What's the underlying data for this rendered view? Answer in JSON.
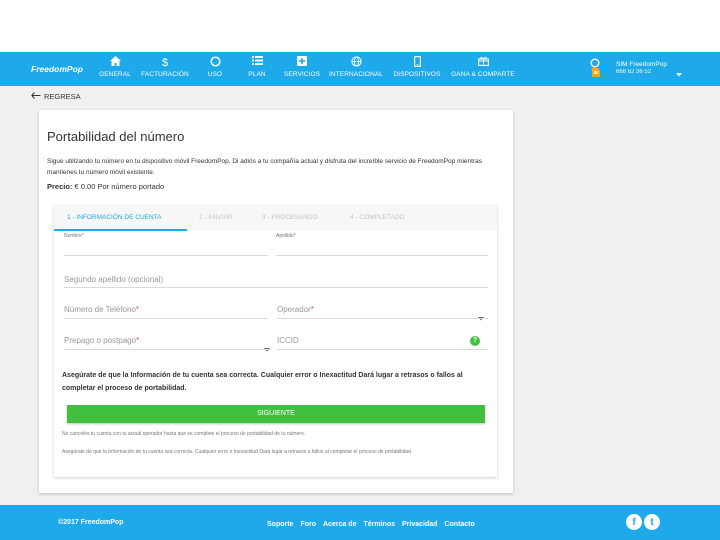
{
  "nav": {
    "logo": "FreedomPop",
    "items": [
      {
        "label": "GENERAL",
        "icon": "home-icon"
      },
      {
        "label": "FACTURACIÓN",
        "icon": "dollar-icon"
      },
      {
        "label": "USO",
        "icon": "circle-icon"
      },
      {
        "label": "PLAN",
        "icon": "list-icon"
      },
      {
        "label": "SERVICIOS",
        "icon": "plus-box-icon"
      },
      {
        "label": "INTERNACIONAL",
        "icon": "globe-icon"
      },
      {
        "label": "DISPOSITIVOS",
        "icon": "phone-icon"
      },
      {
        "label": "GANA & COMPARTE",
        "icon": "gift-icon"
      }
    ],
    "user": {
      "name": "SIM FreedomPop",
      "phone": "668 62 36 52"
    }
  },
  "back_label": "REGRESA",
  "card": {
    "title": "Portabilidad del número",
    "intro": "Sigue utilizando tu número en tu dispositivo móvil FreedomPop. Di adiós a tu compañía actual y disfruta del increíble servicio de FreedomPop mientras mantienes tu número móvil existente.",
    "price_label": "Precio:",
    "price_value": "€ 0.00 Por número portado"
  },
  "steps": [
    {
      "label": "1 - INFORMACIÓN DE CUENTA",
      "active": true
    },
    {
      "label": "2 - ENVIAR",
      "active": false
    },
    {
      "label": "3 - PROCESANDO",
      "active": false
    },
    {
      "label": "4 - COMPLETADO",
      "active": false
    }
  ],
  "form": {
    "nombre": "Nombre",
    "apellido": "Apellido",
    "segundo_apellido": "Segundo apellido (opcional)",
    "telefono": "Número de Teléfono",
    "operador": "Operador",
    "prepago": "Prepago o postpago",
    "iccid": "ICCID",
    "required_mark": "*",
    "help_glyph": "?"
  },
  "warning": "Asegúrate de que la Información de tu cuenta sea correcta. Cualquier error o Inexactitud Dará lugar a retrasos o fallos al completar el proceso de portabilidad.",
  "next_button": "SIGUIENTE",
  "note1": "No canceles tu cuenta con tu actual operador hasta que se complete el proceso de portabilidad de tu número.",
  "note2": "Asegúrate de que la Información de tu cuenta sea correcta. Cualquier error o Inexactitud Dará lugar a retrasos o fallos al completar el proceso de portabilidad.",
  "footer": {
    "copyright": "©2017 FreedomPop",
    "links": [
      "Soporte",
      "Foro",
      "Acerca de",
      "Términos",
      "Privacidad",
      "Contacto"
    ],
    "facebook_glyph": "f",
    "twitter_glyph": "t"
  },
  "colors": {
    "primary": "#1ea9ea",
    "accent_green": "#41c03f"
  }
}
